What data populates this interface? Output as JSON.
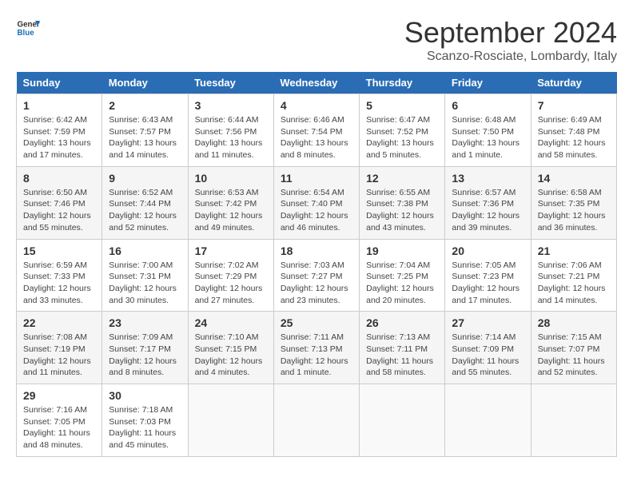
{
  "logo": {
    "line1": "General",
    "line2": "Blue"
  },
  "title": "September 2024",
  "location": "Scanzo-Rosciate, Lombardy, Italy",
  "days_of_week": [
    "Sunday",
    "Monday",
    "Tuesday",
    "Wednesday",
    "Thursday",
    "Friday",
    "Saturday"
  ],
  "weeks": [
    [
      {
        "day": "1",
        "info": "Sunrise: 6:42 AM\nSunset: 7:59 PM\nDaylight: 13 hours and 17 minutes."
      },
      {
        "day": "2",
        "info": "Sunrise: 6:43 AM\nSunset: 7:57 PM\nDaylight: 13 hours and 14 minutes."
      },
      {
        "day": "3",
        "info": "Sunrise: 6:44 AM\nSunset: 7:56 PM\nDaylight: 13 hours and 11 minutes."
      },
      {
        "day": "4",
        "info": "Sunrise: 6:46 AM\nSunset: 7:54 PM\nDaylight: 13 hours and 8 minutes."
      },
      {
        "day": "5",
        "info": "Sunrise: 6:47 AM\nSunset: 7:52 PM\nDaylight: 13 hours and 5 minutes."
      },
      {
        "day": "6",
        "info": "Sunrise: 6:48 AM\nSunset: 7:50 PM\nDaylight: 13 hours and 1 minute."
      },
      {
        "day": "7",
        "info": "Sunrise: 6:49 AM\nSunset: 7:48 PM\nDaylight: 12 hours and 58 minutes."
      }
    ],
    [
      {
        "day": "8",
        "info": "Sunrise: 6:50 AM\nSunset: 7:46 PM\nDaylight: 12 hours and 55 minutes."
      },
      {
        "day": "9",
        "info": "Sunrise: 6:52 AM\nSunset: 7:44 PM\nDaylight: 12 hours and 52 minutes."
      },
      {
        "day": "10",
        "info": "Sunrise: 6:53 AM\nSunset: 7:42 PM\nDaylight: 12 hours and 49 minutes."
      },
      {
        "day": "11",
        "info": "Sunrise: 6:54 AM\nSunset: 7:40 PM\nDaylight: 12 hours and 46 minutes."
      },
      {
        "day": "12",
        "info": "Sunrise: 6:55 AM\nSunset: 7:38 PM\nDaylight: 12 hours and 43 minutes."
      },
      {
        "day": "13",
        "info": "Sunrise: 6:57 AM\nSunset: 7:36 PM\nDaylight: 12 hours and 39 minutes."
      },
      {
        "day": "14",
        "info": "Sunrise: 6:58 AM\nSunset: 7:35 PM\nDaylight: 12 hours and 36 minutes."
      }
    ],
    [
      {
        "day": "15",
        "info": "Sunrise: 6:59 AM\nSunset: 7:33 PM\nDaylight: 12 hours and 33 minutes."
      },
      {
        "day": "16",
        "info": "Sunrise: 7:00 AM\nSunset: 7:31 PM\nDaylight: 12 hours and 30 minutes."
      },
      {
        "day": "17",
        "info": "Sunrise: 7:02 AM\nSunset: 7:29 PM\nDaylight: 12 hours and 27 minutes."
      },
      {
        "day": "18",
        "info": "Sunrise: 7:03 AM\nSunset: 7:27 PM\nDaylight: 12 hours and 23 minutes."
      },
      {
        "day": "19",
        "info": "Sunrise: 7:04 AM\nSunset: 7:25 PM\nDaylight: 12 hours and 20 minutes."
      },
      {
        "day": "20",
        "info": "Sunrise: 7:05 AM\nSunset: 7:23 PM\nDaylight: 12 hours and 17 minutes."
      },
      {
        "day": "21",
        "info": "Sunrise: 7:06 AM\nSunset: 7:21 PM\nDaylight: 12 hours and 14 minutes."
      }
    ],
    [
      {
        "day": "22",
        "info": "Sunrise: 7:08 AM\nSunset: 7:19 PM\nDaylight: 12 hours and 11 minutes."
      },
      {
        "day": "23",
        "info": "Sunrise: 7:09 AM\nSunset: 7:17 PM\nDaylight: 12 hours and 8 minutes."
      },
      {
        "day": "24",
        "info": "Sunrise: 7:10 AM\nSunset: 7:15 PM\nDaylight: 12 hours and 4 minutes."
      },
      {
        "day": "25",
        "info": "Sunrise: 7:11 AM\nSunset: 7:13 PM\nDaylight: 12 hours and 1 minute."
      },
      {
        "day": "26",
        "info": "Sunrise: 7:13 AM\nSunset: 7:11 PM\nDaylight: 11 hours and 58 minutes."
      },
      {
        "day": "27",
        "info": "Sunrise: 7:14 AM\nSunset: 7:09 PM\nDaylight: 11 hours and 55 minutes."
      },
      {
        "day": "28",
        "info": "Sunrise: 7:15 AM\nSunset: 7:07 PM\nDaylight: 11 hours and 52 minutes."
      }
    ],
    [
      {
        "day": "29",
        "info": "Sunrise: 7:16 AM\nSunset: 7:05 PM\nDaylight: 11 hours and 48 minutes."
      },
      {
        "day": "30",
        "info": "Sunrise: 7:18 AM\nSunset: 7:03 PM\nDaylight: 11 hours and 45 minutes."
      },
      {
        "day": "",
        "info": ""
      },
      {
        "day": "",
        "info": ""
      },
      {
        "day": "",
        "info": ""
      },
      {
        "day": "",
        "info": ""
      },
      {
        "day": "",
        "info": ""
      }
    ]
  ]
}
